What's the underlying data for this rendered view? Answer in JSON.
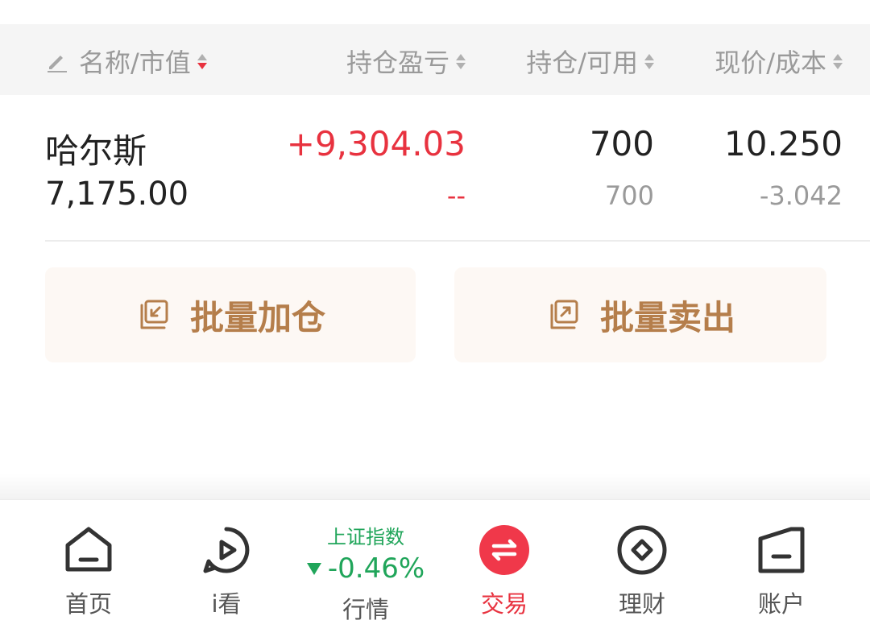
{
  "header": {
    "name_col": "名称/市值",
    "pl_col": "持仓盈亏",
    "position_col": "持仓/可用",
    "price_col": "现价/成本"
  },
  "holding": {
    "name": "哈尔斯",
    "market_value": "7,175.00",
    "profit_loss": "+9,304.03",
    "profit_loss_ratio": "--",
    "position": "700",
    "available": "700",
    "current_price": "10.250",
    "cost": "-3.042"
  },
  "actions": {
    "batch_add_label": "批量加仓",
    "batch_sell_label": "批量卖出"
  },
  "tabbar": {
    "home_label": "首页",
    "ikan_label": "i看",
    "market_index_name": "上证指数",
    "market_index_change": "-0.46%",
    "market_label": "行情",
    "trade_label": "交易",
    "wealth_label": "理财",
    "account_label": "账户"
  },
  "colors": {
    "up_red": "#e8323f",
    "down_green": "#20a55a",
    "action_brown": "#b57e4b"
  }
}
